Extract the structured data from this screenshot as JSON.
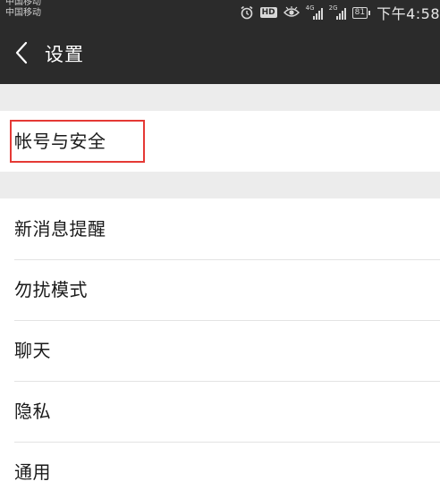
{
  "status_bar": {
    "carrier_1": "中国移动",
    "carrier_2": "中国移动",
    "hd_label": "HD",
    "net_1": "4G",
    "net_2": "2G",
    "battery": "81",
    "time": "下午4:58",
    "icons": [
      "alarm-icon",
      "hd-icon",
      "eye-icon",
      "signal-4g-icon",
      "signal-2g-icon",
      "battery-icon"
    ]
  },
  "nav": {
    "back_icon": "chevron-left-icon",
    "title": "设置"
  },
  "account_group": {
    "items": [
      {
        "label": "帐号与安全"
      }
    ]
  },
  "settings_group": {
    "items": [
      {
        "label": "新消息提醒"
      },
      {
        "label": "勿扰模式"
      },
      {
        "label": "聊天"
      },
      {
        "label": "隐私"
      },
      {
        "label": "通用"
      }
    ]
  },
  "colors": {
    "header_bg": "#2b2b2b",
    "page_bg": "#ececec",
    "row_bg": "#ffffff",
    "highlight": "#e53935"
  }
}
